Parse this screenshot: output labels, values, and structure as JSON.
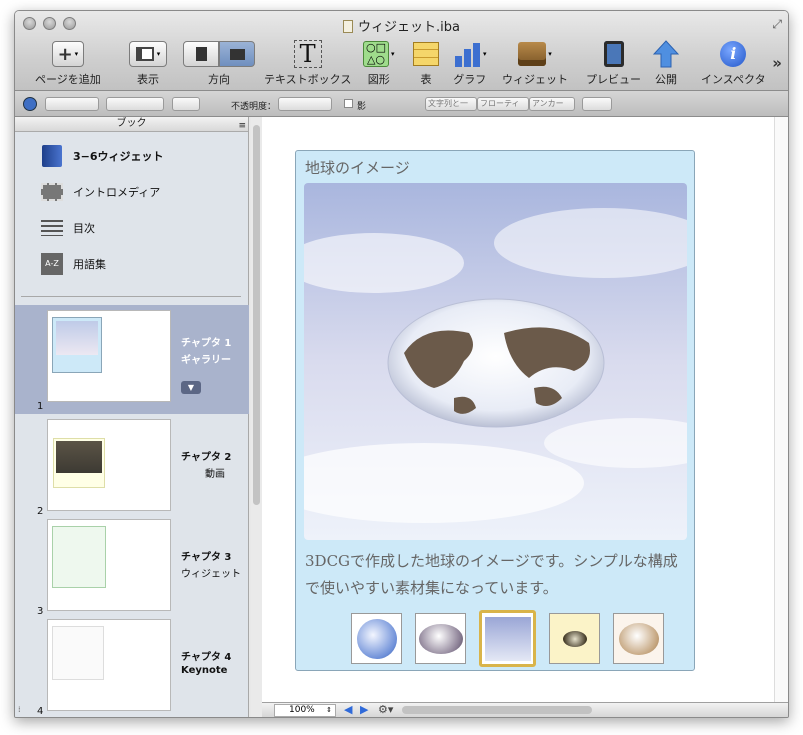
{
  "window": {
    "title": "ウィジェット.iba"
  },
  "toolbar": {
    "add_page": "ページを追加",
    "view": "表示",
    "orientation": "方向",
    "textbox": "テキストボックス",
    "shapes": "図形",
    "table": "表",
    "graph": "グラフ",
    "widget": "ウィジェット",
    "preview": "プレビュー",
    "publish": "公開",
    "inspector": "インスペクタ",
    "overflow": "»"
  },
  "formatbar": {
    "opacity_label": "不透明度：",
    "shadow_label": "影",
    "wrap_label": "文字列と一",
    "float_label": "フローティ",
    "anchor_label": "アンカー"
  },
  "sidebar": {
    "header": "ブック",
    "items": [
      {
        "label": "3−6ウィジェット",
        "icon": "book-icon"
      },
      {
        "label": "イントロメディア",
        "icon": "film-icon"
      },
      {
        "label": "目次",
        "icon": "list-icon"
      },
      {
        "label": "用語集",
        "icon": "glossary-icon",
        "icon_text": "A-Z"
      }
    ],
    "chapters": [
      {
        "num": "1",
        "title": "チャプタ 1",
        "sub": "ギャラリー",
        "selected": true
      },
      {
        "num": "2",
        "title": "チャプタ 2",
        "sub": "動画",
        "selected": false
      },
      {
        "num": "3",
        "title": "チャプタ 3",
        "sub": "ウィジェット",
        "selected": false
      },
      {
        "num": "4",
        "title": "チャプタ 4",
        "sub": "Keynote",
        "selected": false
      }
    ]
  },
  "gallery": {
    "title": "地球のイメージ",
    "caption": "3DCGで作成した地球のイメージです。シンプルな構成で使いやすい素材集になっています。",
    "selected_index": 2,
    "thumbnail_count": 5
  },
  "statusbar": {
    "zoom": "100%"
  },
  "colors": {
    "selection": "#a9b3cc",
    "widget_bg": "#cde9f8",
    "accent_gold": "#d9b44a"
  }
}
